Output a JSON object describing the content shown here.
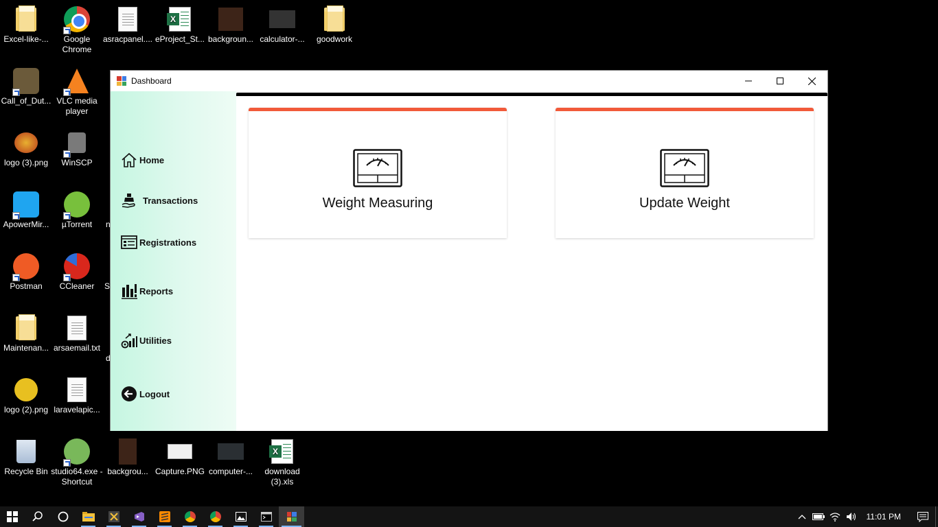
{
  "desktop": {
    "icons": [
      {
        "label": "Excel-like-...",
        "icon": "folder-icon"
      },
      {
        "label": "Google Chrome",
        "icon": "chrome-icon"
      },
      {
        "label": "asracpanel....",
        "icon": "text-file-icon"
      },
      {
        "label": "eProject_St...",
        "icon": "excel-file-icon"
      },
      {
        "label": "backgroun...",
        "icon": "image-file-icon"
      },
      {
        "label": "calculator-...",
        "icon": "image-file-icon"
      },
      {
        "label": "goodwork",
        "icon": "folder-icon"
      },
      {
        "label": "Call_of_Dut...",
        "icon": "game-icon"
      },
      {
        "label": "VLC media player",
        "icon": "vlc-icon"
      },
      {
        "label": "logo (3).png",
        "icon": "image-file-icon"
      },
      {
        "label": "WinSCP",
        "icon": "winscp-icon"
      },
      {
        "label": "ApowerMir...",
        "icon": "apowermirror-icon"
      },
      {
        "label": "µTorrent",
        "icon": "utorrent-icon"
      },
      {
        "label": "Postman",
        "icon": "postman-icon"
      },
      {
        "label": "CCleaner",
        "icon": "ccleaner-icon"
      },
      {
        "label": "Maintenan...",
        "icon": "folder-icon"
      },
      {
        "label": "arsaemail.txt",
        "icon": "text-file-icon"
      },
      {
        "label": "logo (2).png",
        "icon": "image-file-icon"
      },
      {
        "label": "laravelapic...",
        "icon": "text-file-icon"
      },
      {
        "label": "Recycle Bin",
        "icon": "recycle-bin-icon"
      },
      {
        "label": "studio64.exe - Shortcut",
        "icon": "android-studio-icon"
      },
      {
        "label": "backgrou...",
        "icon": "image-file-icon"
      },
      {
        "label": "Capture.PNG",
        "icon": "image-file-icon"
      },
      {
        "label": "computer-...",
        "icon": "image-file-icon"
      },
      {
        "label": "download (3).xls",
        "icon": "excel-file-icon"
      }
    ],
    "partial_labels": [
      "n",
      "S",
      "d"
    ]
  },
  "window": {
    "title": "Dashboard",
    "controls": {
      "minimize": "minimize",
      "maximize": "maximize",
      "close": "close"
    }
  },
  "sidebar": {
    "items": [
      {
        "label": "Home",
        "icon": "home-icon"
      },
      {
        "label": "Transactions",
        "icon": "transactions-icon"
      },
      {
        "label": "Registrations",
        "icon": "registrations-icon"
      },
      {
        "label": "Reports",
        "icon": "reports-icon"
      },
      {
        "label": "Utilities",
        "icon": "utilities-icon"
      },
      {
        "label": "Logout",
        "icon": "logout-icon"
      }
    ]
  },
  "cards": [
    {
      "title": "Weight Measuring",
      "icon": "scale-icon"
    },
    {
      "title": "Update Weight",
      "icon": "scale-icon"
    }
  ],
  "colors": {
    "card_accent": "#f15a3a",
    "sidebar_gradient_start": "#c5f6e1",
    "sidebar_gradient_end": "#eefcf5",
    "taskbar": "#141414"
  },
  "taskbar": {
    "time": "11:01 PM"
  }
}
